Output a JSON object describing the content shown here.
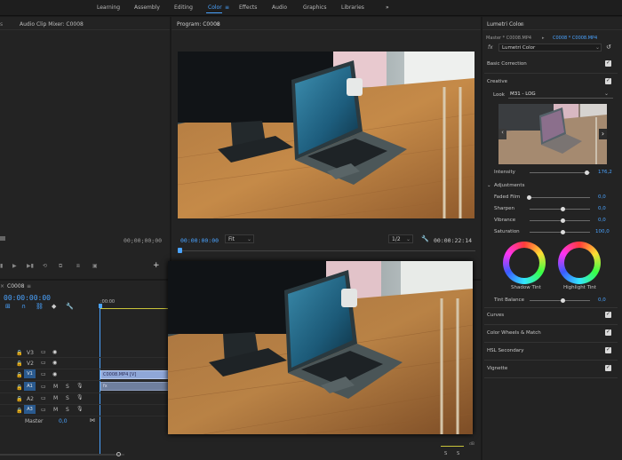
{
  "workspaces": {
    "tabs": [
      "Learning",
      "Assembly",
      "Editing",
      "Color",
      "Effects",
      "Audio",
      "Graphics",
      "Libraries"
    ],
    "active": "Color",
    "more": "»"
  },
  "source_panel": {
    "title": "Audio Clip Mixer: C0008",
    "timecode": "00;00;00;00"
  },
  "program_monitor": {
    "title": "Program: C0008",
    "current_time": "00:00:00:00",
    "zoom": "Fit",
    "resolution": "1/2",
    "duration": "00:00:22:14"
  },
  "timeline": {
    "title": "C0008",
    "timecode": "00:00:00:00",
    "ruler_start": ":00:00",
    "tracks": [
      {
        "name": "V3",
        "type": "video"
      },
      {
        "name": "V2",
        "type": "video"
      },
      {
        "name": "V1",
        "type": "video",
        "target": true
      },
      {
        "name": "A1",
        "type": "audio",
        "target": true
      },
      {
        "name": "A2",
        "type": "audio"
      },
      {
        "name": "A3",
        "type": "audio",
        "target": true
      }
    ],
    "master_label": "Master",
    "master_value": "0,0",
    "clip_video": "C0008.MP4 [V]",
    "clip_audio_marker": "fx",
    "meter_solo_1": "S",
    "meter_solo_2": "S",
    "meter_db": "dB"
  },
  "lumetri": {
    "title": "Lumetri Color",
    "master_clip": "Master * C0008.MP4",
    "sequence_clip": "C0008 * C0008.MP4",
    "fx_label": "fx",
    "effect_name": "Lumetri Color",
    "basic_correction": "Basic Correction",
    "creative": "Creative",
    "look_label": "Look",
    "look_value": "M31 - LOG",
    "intensity_label": "Intensity",
    "intensity_value": "176,2",
    "adjustments_label": "Adjustments",
    "faded_film_label": "Faded Film",
    "faded_film_value": "0,0",
    "sharpen_label": "Sharpen",
    "sharpen_value": "0,0",
    "vibrance_label": "Vibrance",
    "vibrance_value": "0,0",
    "saturation_label": "Saturation",
    "saturation_value": "100,0",
    "shadow_tint_label": "Shadow Tint",
    "highlight_tint_label": "Highlight Tint",
    "tint_balance_label": "Tint Balance",
    "tint_balance_value": "0,0",
    "curves": "Curves",
    "color_wheels": "Color Wheels & Match",
    "hsl_secondary": "HSL Secondary",
    "vignette": "Vignette"
  },
  "colors": {
    "accent": "#4aa3ff",
    "panel_bg": "#232323",
    "app_bg": "#1a1a1a",
    "clip_video": "#8fa7d8",
    "target_blue": "#2a5a8f"
  }
}
